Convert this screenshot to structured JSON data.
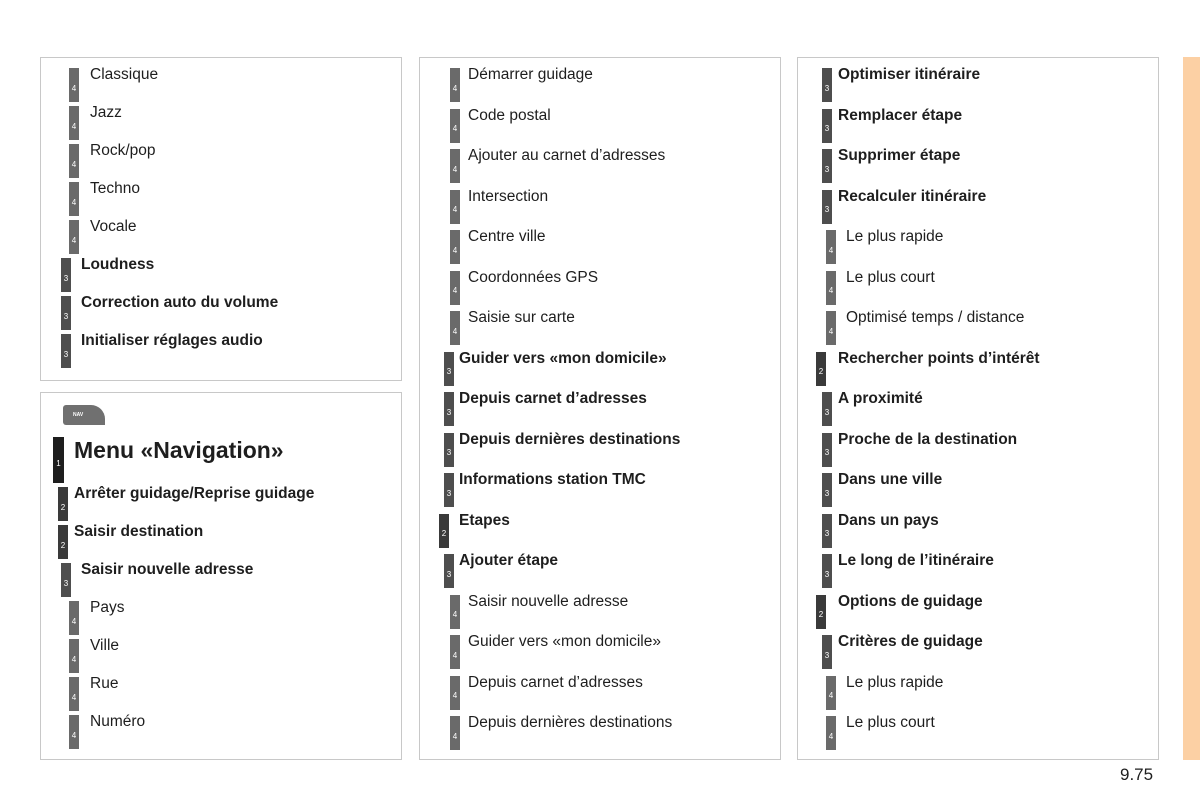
{
  "page": {
    "number": "9.75"
  },
  "colors": {
    "side_tab": "#fcd0a4",
    "level1": "#1e1e1e",
    "level2": "#3a3a3a",
    "level3": "#4e4e4e",
    "level4": "#6a6a6a"
  },
  "panel_audio": {
    "items": [
      {
        "level": "4",
        "label": "Classique"
      },
      {
        "level": "4",
        "label": "Jazz"
      },
      {
        "level": "4",
        "label": "Rock/pop"
      },
      {
        "level": "4",
        "label": "Techno"
      },
      {
        "level": "4",
        "label": "Vocale"
      },
      {
        "level": "3",
        "label": "Loudness"
      },
      {
        "level": "3",
        "label": "Correction auto du volume"
      },
      {
        "level": "3",
        "label": "Initialiser réglages audio"
      }
    ]
  },
  "panel_nav": {
    "icon_label": "NAV",
    "title": {
      "level": "1",
      "label": "Menu «Navigation»"
    },
    "items": [
      {
        "level": "2",
        "label": "Arrêter guidage/Reprise guidage"
      },
      {
        "level": "2",
        "label": "Saisir destination"
      },
      {
        "level": "3",
        "label": "Saisir nouvelle adresse"
      },
      {
        "level": "4",
        "label": "Pays"
      },
      {
        "level": "4",
        "label": "Ville"
      },
      {
        "level": "4",
        "label": "Rue"
      },
      {
        "level": "4",
        "label": "Numéro"
      }
    ]
  },
  "panel_middle": {
    "items": [
      {
        "level": "4",
        "label": "Démarrer guidage"
      },
      {
        "level": "4",
        "label": "Code postal"
      },
      {
        "level": "4",
        "label": "Ajouter au carnet d’adresses"
      },
      {
        "level": "4",
        "label": "Intersection"
      },
      {
        "level": "4",
        "label": "Centre ville"
      },
      {
        "level": "4",
        "label": "Coordonnées GPS"
      },
      {
        "level": "4",
        "label": "Saisie sur carte"
      },
      {
        "level": "3",
        "label": "Guider vers «mon domicile»"
      },
      {
        "level": "3",
        "label": "Depuis carnet d’adresses"
      },
      {
        "level": "3",
        "label": "Depuis dernières destinations"
      },
      {
        "level": "3",
        "label": "Informations station TMC"
      },
      {
        "level": "2",
        "label": "Etapes"
      },
      {
        "level": "3",
        "label": "Ajouter étape"
      },
      {
        "level": "4",
        "label": "Saisir nouvelle adresse"
      },
      {
        "level": "4",
        "label": "Guider vers «mon domicile»"
      },
      {
        "level": "4",
        "label": "Depuis carnet d’adresses"
      },
      {
        "level": "4",
        "label": "Depuis dernières destinations"
      }
    ]
  },
  "panel_right": {
    "items": [
      {
        "level": "3",
        "label": "Optimiser itinéraire"
      },
      {
        "level": "3",
        "label": "Remplacer étape"
      },
      {
        "level": "3",
        "label": "Supprimer étape"
      },
      {
        "level": "3",
        "label": "Recalculer itinéraire"
      },
      {
        "level": "4",
        "label": "Le plus rapide"
      },
      {
        "level": "4",
        "label": "Le plus court"
      },
      {
        "level": "4",
        "label": "Optimisé temps / distance"
      },
      {
        "level": "2",
        "label": "Rechercher points d’intérêt"
      },
      {
        "level": "3",
        "label": "A proximité"
      },
      {
        "level": "3",
        "label": "Proche de la destination"
      },
      {
        "level": "3",
        "label": "Dans une ville"
      },
      {
        "level": "3",
        "label": "Dans un pays"
      },
      {
        "level": "3",
        "label": "Le long de l’itinéraire"
      },
      {
        "level": "2",
        "label": "Options de guidage"
      },
      {
        "level": "3",
        "label": "Critères de guidage"
      },
      {
        "level": "4",
        "label": "Le plus rapide"
      },
      {
        "level": "4",
        "label": "Le plus court"
      }
    ]
  }
}
